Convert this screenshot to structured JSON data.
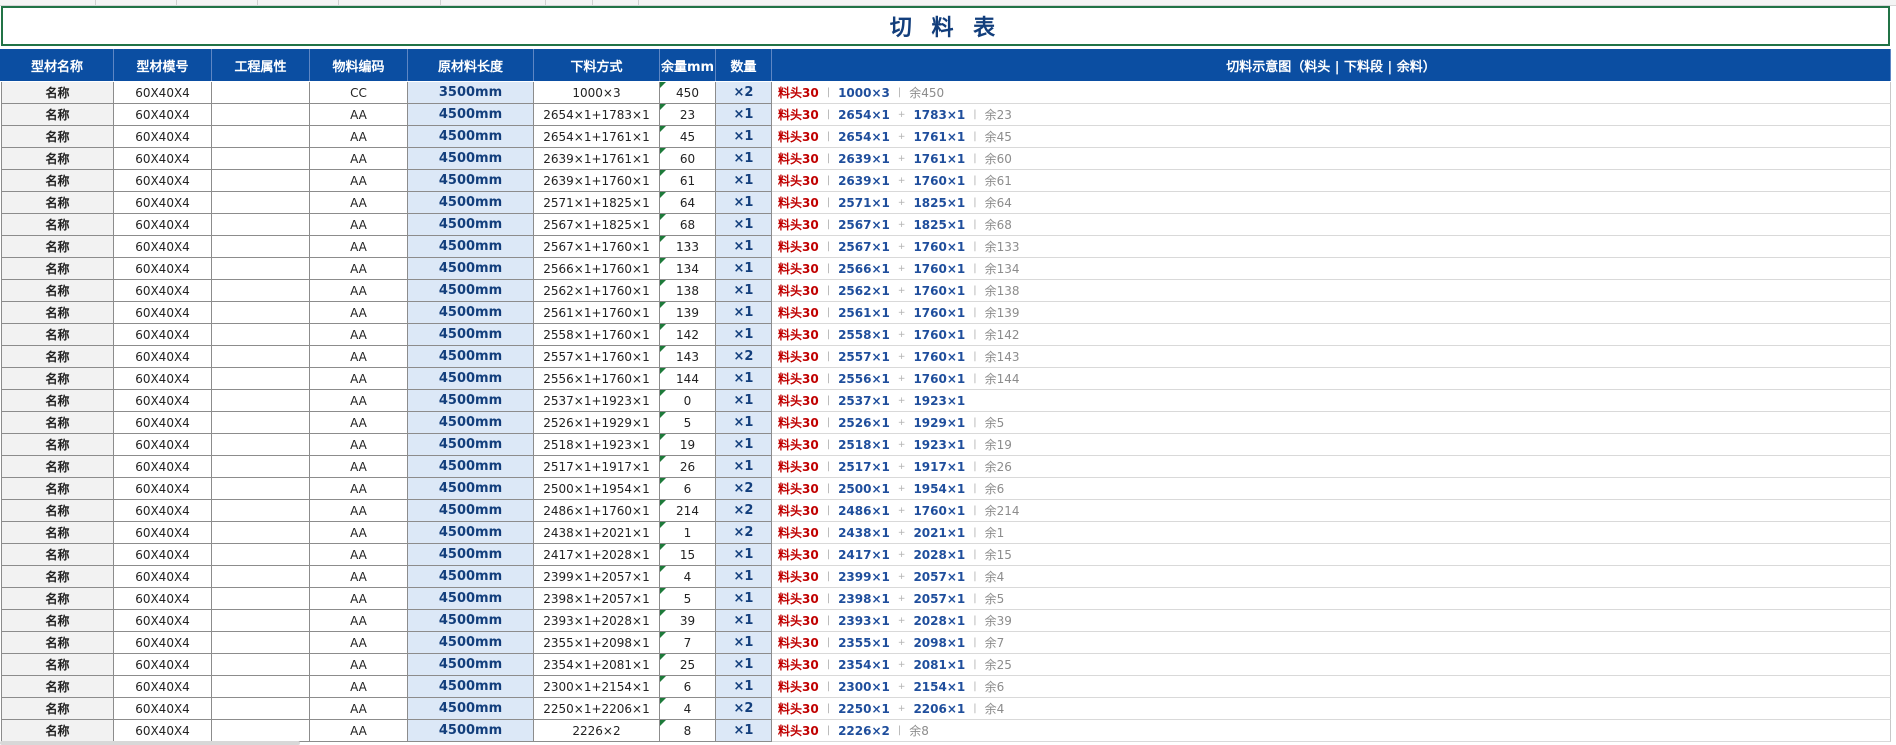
{
  "sheet": {
    "title": "切 料 表",
    "headers": [
      "型材名称",
      "型材模号",
      "工程属性",
      "物料编码",
      "原材料长度",
      "下料方式",
      "余量mm",
      "数量",
      "切料示意图（料头 | 下料段 | 余料）"
    ],
    "rows": [
      {
        "name": "名称",
        "model": "60X40X4",
        "prop": "",
        "code": "CC",
        "len": "3500mm",
        "mode": "1000×3",
        "rem": "450",
        "qty": "×2",
        "vis_head": "料头30",
        "vis_segs": [
          "1000×3"
        ],
        "vis_rest": "余450"
      },
      {
        "name": "名称",
        "model": "60X40X4",
        "prop": "",
        "code": "AA",
        "len": "4500mm",
        "mode": "2654×1+1783×1",
        "rem": "23",
        "qty": "×1",
        "vis_head": "料头30",
        "vis_segs": [
          "2654×1",
          "1783×1"
        ],
        "vis_rest": "余23"
      },
      {
        "name": "名称",
        "model": "60X40X4",
        "prop": "",
        "code": "AA",
        "len": "4500mm",
        "mode": "2654×1+1761×1",
        "rem": "45",
        "qty": "×1",
        "vis_head": "料头30",
        "vis_segs": [
          "2654×1",
          "1761×1"
        ],
        "vis_rest": "余45"
      },
      {
        "name": "名称",
        "model": "60X40X4",
        "prop": "",
        "code": "AA",
        "len": "4500mm",
        "mode": "2639×1+1761×1",
        "rem": "60",
        "qty": "×1",
        "vis_head": "料头30",
        "vis_segs": [
          "2639×1",
          "1761×1"
        ],
        "vis_rest": "余60"
      },
      {
        "name": "名称",
        "model": "60X40X4",
        "prop": "",
        "code": "AA",
        "len": "4500mm",
        "mode": "2639×1+1760×1",
        "rem": "61",
        "qty": "×1",
        "vis_head": "料头30",
        "vis_segs": [
          "2639×1",
          "1760×1"
        ],
        "vis_rest": "余61"
      },
      {
        "name": "名称",
        "model": "60X40X4",
        "prop": "",
        "code": "AA",
        "len": "4500mm",
        "mode": "2571×1+1825×1",
        "rem": "64",
        "qty": "×1",
        "vis_head": "料头30",
        "vis_segs": [
          "2571×1",
          "1825×1"
        ],
        "vis_rest": "余64"
      },
      {
        "name": "名称",
        "model": "60X40X4",
        "prop": "",
        "code": "AA",
        "len": "4500mm",
        "mode": "2567×1+1825×1",
        "rem": "68",
        "qty": "×1",
        "vis_head": "料头30",
        "vis_segs": [
          "2567×1",
          "1825×1"
        ],
        "vis_rest": "余68"
      },
      {
        "name": "名称",
        "model": "60X40X4",
        "prop": "",
        "code": "AA",
        "len": "4500mm",
        "mode": "2567×1+1760×1",
        "rem": "133",
        "qty": "×1",
        "vis_head": "料头30",
        "vis_segs": [
          "2567×1",
          "1760×1"
        ],
        "vis_rest": "余133"
      },
      {
        "name": "名称",
        "model": "60X40X4",
        "prop": "",
        "code": "AA",
        "len": "4500mm",
        "mode": "2566×1+1760×1",
        "rem": "134",
        "qty": "×1",
        "vis_head": "料头30",
        "vis_segs": [
          "2566×1",
          "1760×1"
        ],
        "vis_rest": "余134"
      },
      {
        "name": "名称",
        "model": "60X40X4",
        "prop": "",
        "code": "AA",
        "len": "4500mm",
        "mode": "2562×1+1760×1",
        "rem": "138",
        "qty": "×1",
        "vis_head": "料头30",
        "vis_segs": [
          "2562×1",
          "1760×1"
        ],
        "vis_rest": "余138"
      },
      {
        "name": "名称",
        "model": "60X40X4",
        "prop": "",
        "code": "AA",
        "len": "4500mm",
        "mode": "2561×1+1760×1",
        "rem": "139",
        "qty": "×1",
        "vis_head": "料头30",
        "vis_segs": [
          "2561×1",
          "1760×1"
        ],
        "vis_rest": "余139"
      },
      {
        "name": "名称",
        "model": "60X40X4",
        "prop": "",
        "code": "AA",
        "len": "4500mm",
        "mode": "2558×1+1760×1",
        "rem": "142",
        "qty": "×1",
        "vis_head": "料头30",
        "vis_segs": [
          "2558×1",
          "1760×1"
        ],
        "vis_rest": "余142"
      },
      {
        "name": "名称",
        "model": "60X40X4",
        "prop": "",
        "code": "AA",
        "len": "4500mm",
        "mode": "2557×1+1760×1",
        "rem": "143",
        "qty": "×2",
        "vis_head": "料头30",
        "vis_segs": [
          "2557×1",
          "1760×1"
        ],
        "vis_rest": "余143"
      },
      {
        "name": "名称",
        "model": "60X40X4",
        "prop": "",
        "code": "AA",
        "len": "4500mm",
        "mode": "2556×1+1760×1",
        "rem": "144",
        "qty": "×1",
        "vis_head": "料头30",
        "vis_segs": [
          "2556×1",
          "1760×1"
        ],
        "vis_rest": "余144"
      },
      {
        "name": "名称",
        "model": "60X40X4",
        "prop": "",
        "code": "AA",
        "len": "4500mm",
        "mode": "2537×1+1923×1",
        "rem": "0",
        "qty": "×1",
        "vis_head": "料头30",
        "vis_segs": [
          "2537×1",
          "1923×1"
        ],
        "vis_rest": ""
      },
      {
        "name": "名称",
        "model": "60X40X4",
        "prop": "",
        "code": "AA",
        "len": "4500mm",
        "mode": "2526×1+1929×1",
        "rem": "5",
        "qty": "×1",
        "vis_head": "料头30",
        "vis_segs": [
          "2526×1",
          "1929×1"
        ],
        "vis_rest": "余5"
      },
      {
        "name": "名称",
        "model": "60X40X4",
        "prop": "",
        "code": "AA",
        "len": "4500mm",
        "mode": "2518×1+1923×1",
        "rem": "19",
        "qty": "×1",
        "vis_head": "料头30",
        "vis_segs": [
          "2518×1",
          "1923×1"
        ],
        "vis_rest": "余19"
      },
      {
        "name": "名称",
        "model": "60X40X4",
        "prop": "",
        "code": "AA",
        "len": "4500mm",
        "mode": "2517×1+1917×1",
        "rem": "26",
        "qty": "×1",
        "vis_head": "料头30",
        "vis_segs": [
          "2517×1",
          "1917×1"
        ],
        "vis_rest": "余26"
      },
      {
        "name": "名称",
        "model": "60X40X4",
        "prop": "",
        "code": "AA",
        "len": "4500mm",
        "mode": "2500×1+1954×1",
        "rem": "6",
        "qty": "×2",
        "vis_head": "料头30",
        "vis_segs": [
          "2500×1",
          "1954×1"
        ],
        "vis_rest": "余6"
      },
      {
        "name": "名称",
        "model": "60X40X4",
        "prop": "",
        "code": "AA",
        "len": "4500mm",
        "mode": "2486×1+1760×1",
        "rem": "214",
        "qty": "×2",
        "vis_head": "料头30",
        "vis_segs": [
          "2486×1",
          "1760×1"
        ],
        "vis_rest": "余214"
      },
      {
        "name": "名称",
        "model": "60X40X4",
        "prop": "",
        "code": "AA",
        "len": "4500mm",
        "mode": "2438×1+2021×1",
        "rem": "1",
        "qty": "×2",
        "vis_head": "料头30",
        "vis_segs": [
          "2438×1",
          "2021×1"
        ],
        "vis_rest": "余1"
      },
      {
        "name": "名称",
        "model": "60X40X4",
        "prop": "",
        "code": "AA",
        "len": "4500mm",
        "mode": "2417×1+2028×1",
        "rem": "15",
        "qty": "×1",
        "vis_head": "料头30",
        "vis_segs": [
          "2417×1",
          "2028×1"
        ],
        "vis_rest": "余15"
      },
      {
        "name": "名称",
        "model": "60X40X4",
        "prop": "",
        "code": "AA",
        "len": "4500mm",
        "mode": "2399×1+2057×1",
        "rem": "4",
        "qty": "×1",
        "vis_head": "料头30",
        "vis_segs": [
          "2399×1",
          "2057×1"
        ],
        "vis_rest": "余4"
      },
      {
        "name": "名称",
        "model": "60X40X4",
        "prop": "",
        "code": "AA",
        "len": "4500mm",
        "mode": "2398×1+2057×1",
        "rem": "5",
        "qty": "×1",
        "vis_head": "料头30",
        "vis_segs": [
          "2398×1",
          "2057×1"
        ],
        "vis_rest": "余5"
      },
      {
        "name": "名称",
        "model": "60X40X4",
        "prop": "",
        "code": "AA",
        "len": "4500mm",
        "mode": "2393×1+2028×1",
        "rem": "39",
        "qty": "×1",
        "vis_head": "料头30",
        "vis_segs": [
          "2393×1",
          "2028×1"
        ],
        "vis_rest": "余39"
      },
      {
        "name": "名称",
        "model": "60X40X4",
        "prop": "",
        "code": "AA",
        "len": "4500mm",
        "mode": "2355×1+2098×1",
        "rem": "7",
        "qty": "×1",
        "vis_head": "料头30",
        "vis_segs": [
          "2355×1",
          "2098×1"
        ],
        "vis_rest": "余7"
      },
      {
        "name": "名称",
        "model": "60X40X4",
        "prop": "",
        "code": "AA",
        "len": "4500mm",
        "mode": "2354×1+2081×1",
        "rem": "25",
        "qty": "×1",
        "vis_head": "料头30",
        "vis_segs": [
          "2354×1",
          "2081×1"
        ],
        "vis_rest": "余25"
      },
      {
        "name": "名称",
        "model": "60X40X4",
        "prop": "",
        "code": "AA",
        "len": "4500mm",
        "mode": "2300×1+2154×1",
        "rem": "6",
        "qty": "×1",
        "vis_head": "料头30",
        "vis_segs": [
          "2300×1",
          "2154×1"
        ],
        "vis_rest": "余6"
      },
      {
        "name": "名称",
        "model": "60X40X4",
        "prop": "",
        "code": "AA",
        "len": "4500mm",
        "mode": "2250×1+2206×1",
        "rem": "4",
        "qty": "×2",
        "vis_head": "料头30",
        "vis_segs": [
          "2250×1",
          "2206×1"
        ],
        "vis_rest": "余4"
      },
      {
        "name": "名称",
        "model": "60X40X4",
        "prop": "",
        "code": "AA",
        "len": "4500mm",
        "mode": "2226×2",
        "rem": "8",
        "qty": "×1",
        "vis_head": "料头30",
        "vis_segs": [
          "2226×2"
        ],
        "vis_rest": "余8"
      }
    ]
  },
  "colors": {
    "header_bg": "#0b4ea2",
    "title_border": "#217346",
    "head_text": "#c00000",
    "seg_text": "#1f4e9c",
    "rest_text": "#8c8c8c",
    "len_bg": "#dce8f7"
  }
}
